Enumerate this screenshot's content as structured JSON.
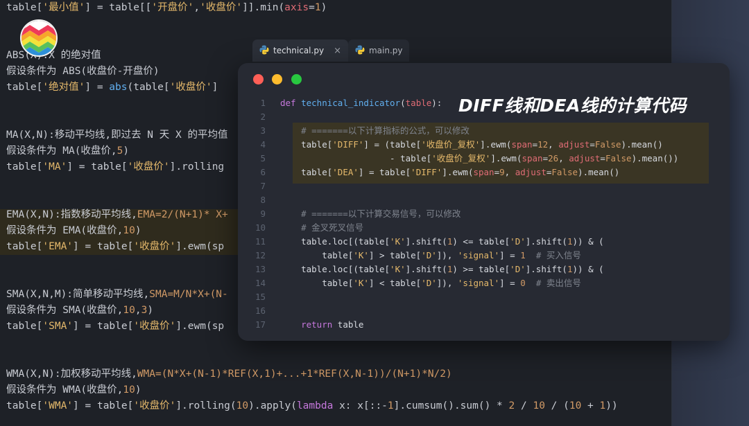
{
  "background_editor": {
    "lines": [
      "table['最小值'] = table[['开盘价','收盘价']].min(axis=1)",
      "ABS(X):X 的绝对值",
      "假设条件为 ABS(收盘价-开盘价)",
      "table['绝对值'] = abs(table['收盘价']",
      "MA(X,N):移动平均线,即过去 N 天 X 的平均值",
      "假设条件为 MA(收盘价,5)",
      "table['MA'] = table['收盘价'].rolling",
      "EMA(X,N):指数移动平均线,EMA=2/(N+1)* X+",
      "假设条件为 EMA(收盘价,10)",
      "table['EMA'] = table['收盘价'].ewm(sp",
      "SMA(X,N,M):简单移动平均线,SMA=M/N*X+(N-",
      "假设条件为 SMA(收盘价,10,3)",
      "table['SMA'] = table['收盘价'].ewm(sp",
      "WMA(X,N):加权移动平均线,WMA=(N*X+(N-1)*REF(X,1)+...+1*REF(X,N-1))/(N+1)*N/2)",
      "假设条件为 WMA(收盘价,10)",
      "table['WMA'] = table['收盘价'].rolling(10).apply(lambda x: x[::-1].cumsum().sum() * 2 / 10 / (10 + 1))"
    ]
  },
  "tabs": [
    {
      "label": "technical.py",
      "close": "×",
      "active": true
    },
    {
      "label": "main.py",
      "active": false
    }
  ],
  "window": {
    "title": "DIFF线和DEA线的计算代码",
    "line_numbers": [
      "1",
      "2",
      "3",
      "4",
      "5",
      "6",
      "7",
      "8",
      "9",
      "10",
      "11",
      "12",
      "13",
      "14",
      "15",
      "16",
      "17"
    ],
    "code_lines": [
      "def technical_indicator(table):",
      "",
      "    # =======以下计算指标的公式，可以修改",
      "    table['DIFF'] = (table['收盘价_复权'].ewm(span=12, adjust=False).mean()",
      "                     - table['收盘价_复权'].ewm(span=26, adjust=False).mean())",
      "    table['DEA'] = table['DIFF'].ewm(span=9, adjust=False).mean()",
      "",
      "",
      "    # =======以下计算交易信号，可以修改",
      "    # 金叉死叉信号",
      "    table.loc[(table['K'].shift(1) <= table['D'].shift(1)) & (",
      "        table['K'] > table['D']), 'signal'] = 1  # 买入信号",
      "    table.loc[(table['K'].shift(1) >= table['D'].shift(1)) & (",
      "        table['K'] < table['D']), 'signal'] = 0  # 卖出信号",
      "",
      "",
      "    return table"
    ]
  },
  "colors": {
    "editor_bg": "#1e2127",
    "window_bg": "#272a33",
    "highlight": "#3a3524",
    "close_dot": "#ff5f57",
    "minimize_dot": "#febc2e",
    "maximize_dot": "#28c840"
  },
  "icons": {
    "logo": "colorful-zigzag-logo",
    "tab_file": "python-file-icon"
  }
}
